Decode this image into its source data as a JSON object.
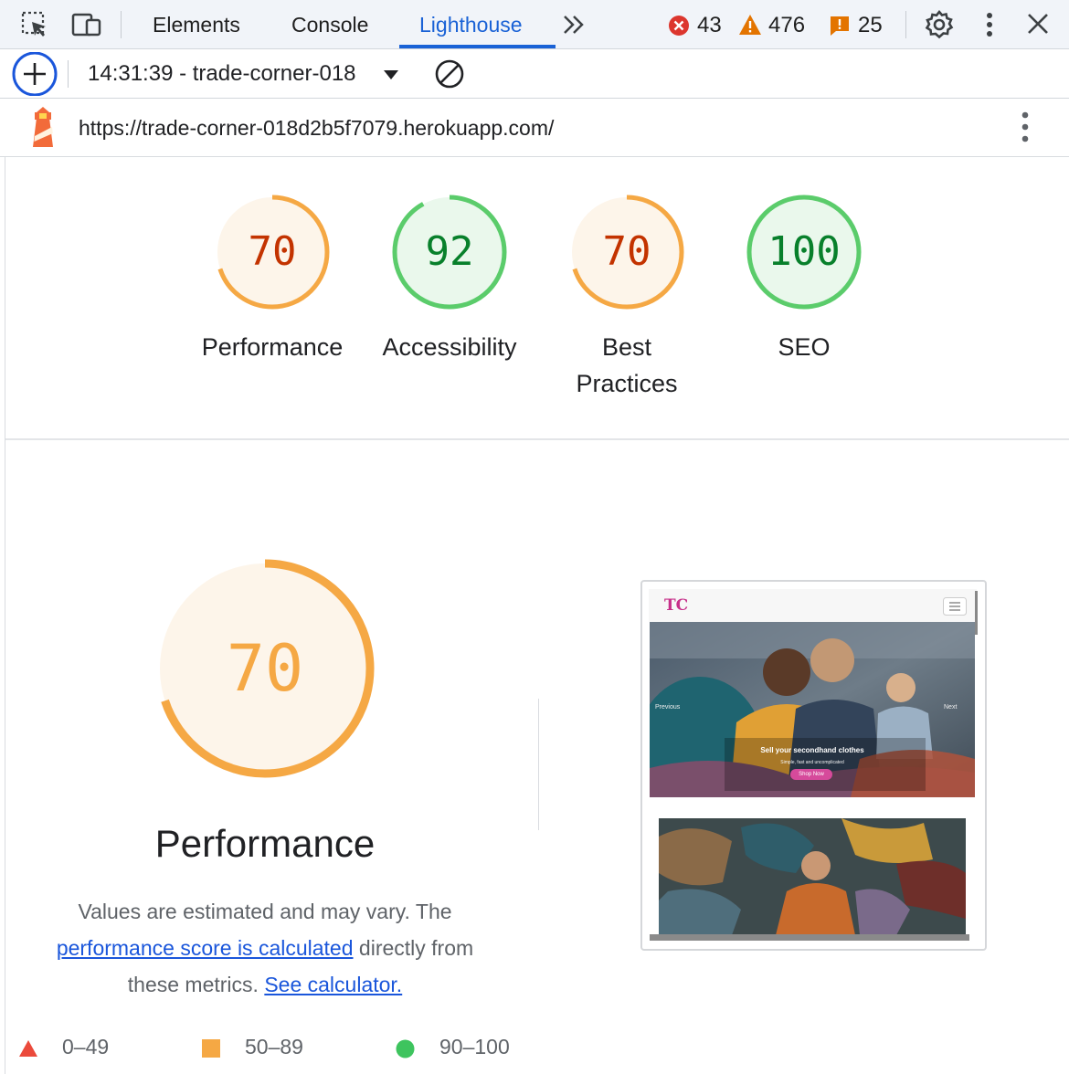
{
  "devtools": {
    "tabs": [
      "Elements",
      "Console",
      "Lighthouse"
    ],
    "active_tab": "Lighthouse",
    "errors": "43",
    "warnings": "476",
    "issues": "25"
  },
  "report_bar": {
    "selected_report": "14:31:39 - trade-corner-018"
  },
  "url_bar": {
    "url": "https://trade-corner-018d2b5f7079.herokuapp.com/"
  },
  "scores": [
    {
      "label": "Performance",
      "value": 70,
      "color": "#f5a844",
      "text_color": "#c33300"
    },
    {
      "label": "Accessibility",
      "value": 92,
      "color": "#5bcc6b",
      "text_color": "#08802b"
    },
    {
      "label": "Best Practices",
      "value": 70,
      "color": "#f5a844",
      "text_color": "#c33300"
    },
    {
      "label": "SEO",
      "value": 100,
      "color": "#5bcc6b",
      "text_color": "#08802b"
    }
  ],
  "performance": {
    "score": 70,
    "title": "Performance",
    "desc_1": "Values are estimated and may vary. The",
    "link_1": "performance score is calculated",
    "desc_2": "directly from",
    "desc_3": "these metrics.",
    "link_2": "See calculator."
  },
  "legend": [
    "0–49",
    "50–89",
    "90–100"
  ],
  "screenshot": {
    "logo": "TC",
    "prev": "Previous",
    "next": "Next",
    "headline": "Sell your secondhand clothes",
    "subline": "Simple, fast and uncomplicated",
    "cta": "Shop Now"
  }
}
